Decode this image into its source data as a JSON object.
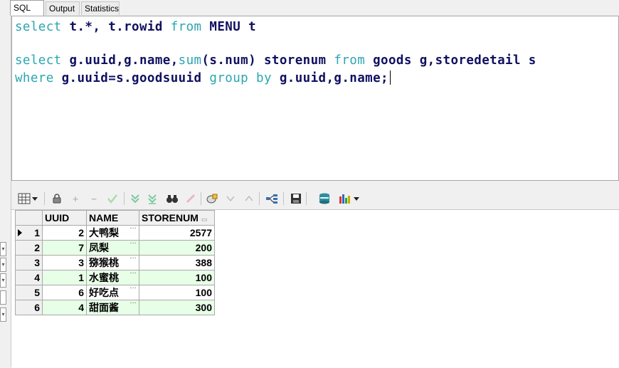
{
  "tabs": [
    {
      "label": "SQL"
    },
    {
      "label": "Output"
    },
    {
      "label": "Statistics"
    }
  ],
  "editor": {
    "line1": {
      "kw1": "select",
      "t1": " t.*, t.rowid ",
      "kw2": "from",
      "t2": " MENU t"
    },
    "line3": {
      "kw1": "select",
      "t1": " g.uuid,g.name,",
      "fn": "sum",
      "t2": "(s.num) storenum ",
      "kw2": "from",
      "t3": " goods g,storedetail s"
    },
    "line4": {
      "kw1": "where",
      "t1": " g.uuid=s.goodsuuid ",
      "kw2": "group by",
      "t2": " g.uuid,g.name;"
    }
  },
  "toolbar": {
    "icons": [
      "grid-layout-icon",
      "dropdown-arrow-icon",
      "lock-icon",
      "add-icon",
      "remove-icon",
      "post-icon",
      "refresh-icon",
      "fetch-all-icon",
      "find-icon",
      "clear-icon",
      "query-by-example-icon",
      "next-page-icon",
      "previous-page-icon",
      "link-icon",
      "save-icon",
      "export-icon",
      "chart-icon"
    ]
  },
  "grid": {
    "columns": [
      "UUID",
      "NAME",
      "STORENUM"
    ],
    "rows": [
      {
        "num": "1",
        "uuid": "2",
        "name": "大鸭梨",
        "store": "2577"
      },
      {
        "num": "2",
        "uuid": "7",
        "name": "凤梨",
        "store": "200"
      },
      {
        "num": "3",
        "uuid": "3",
        "name": "猕猴桃",
        "store": "388"
      },
      {
        "num": "4",
        "uuid": "1",
        "name": "水蜜桃",
        "store": "100"
      },
      {
        "num": "5",
        "uuid": "6",
        "name": "好吃点",
        "store": "100"
      },
      {
        "num": "6",
        "uuid": "4",
        "name": "甜面酱",
        "store": "300"
      }
    ],
    "even_row_color": "#e7ffe7"
  }
}
